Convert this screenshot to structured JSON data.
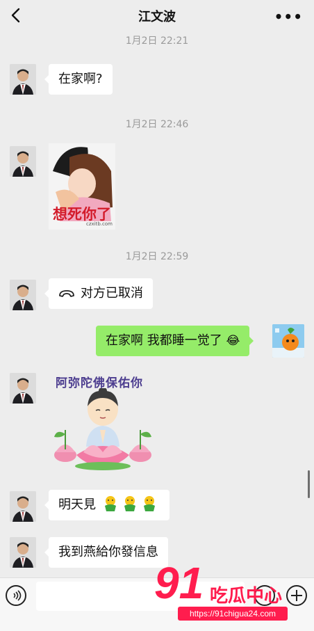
{
  "header": {
    "title": "江文波",
    "back_icon": "chevron-left-icon",
    "more_label": "•••"
  },
  "messages": [
    {
      "time": "1月2日 22:21"
    },
    {
      "from": "contact",
      "text": "在家啊?"
    },
    {
      "time": "1月2日 22:46"
    },
    {
      "from": "contact",
      "sticker_caption": "想死你了",
      "sticker_credit": "czxitb.com"
    },
    {
      "time": "1月2日 22:59"
    },
    {
      "from": "contact",
      "call_icon": "phone-hangup-icon",
      "text": "对方已取消"
    },
    {
      "from": "me",
      "text": "在家啊 我都睡一觉了",
      "emoji": "😂"
    },
    {
      "from": "contact",
      "sticker_caption": "阿弥陀佛保佑你"
    },
    {
      "from": "contact",
      "text": "明天見",
      "emoji_icon": "green-flower-emoji"
    },
    {
      "from": "contact",
      "text": "我到燕給你發信息"
    }
  ],
  "inputbar": {
    "voice_icon": "voice-icon",
    "emoji_icon": "smile-icon",
    "plus_icon": "plus-icon"
  },
  "watermark": {
    "number": "91",
    "name": "吃瓜中心",
    "url": "https://91chigua24.com"
  }
}
